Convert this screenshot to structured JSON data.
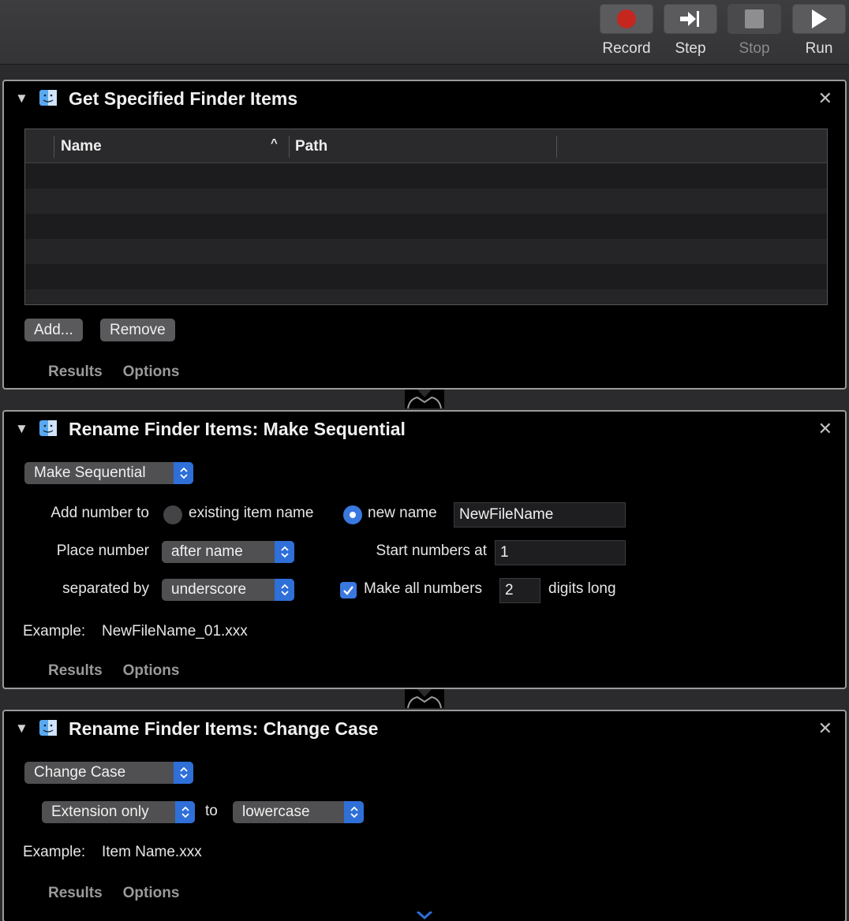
{
  "toolbar": {
    "record": "Record",
    "step": "Step",
    "stop": "Stop",
    "run": "Run"
  },
  "actions": {
    "get_items": {
      "title": "Get Specified Finder Items",
      "columns": [
        "Name",
        "Path"
      ],
      "add_label": "Add...",
      "remove_label": "Remove",
      "results": "Results",
      "options": "Options"
    },
    "sequential": {
      "title": "Rename Finder Items: Make Sequential",
      "mode": "Make Sequential",
      "add_number_to": "Add number to",
      "existing_item_name": "existing item name",
      "new_name": "new name",
      "new_name_value": "NewFileName",
      "place_number": "Place number",
      "place_number_value": "after name",
      "start_numbers_at": "Start numbers at",
      "start_value": "1",
      "separated_by": "separated by",
      "separator_value": "underscore",
      "make_all_numbers": "Make all numbers",
      "digits_value": "2",
      "digits_long": "digits long",
      "example_label": "Example:",
      "example_value": "NewFileName_01.xxx",
      "results": "Results",
      "options": "Options"
    },
    "change_case": {
      "title": "Rename Finder Items: Change Case",
      "mode": "Change Case",
      "scope": "Extension only",
      "to": "to",
      "case_value": "lowercase",
      "example_label": "Example:",
      "example_value": "Item Name.xxx",
      "results": "Results",
      "options": "Options"
    }
  },
  "colors": {
    "accent": "#2f6fd8",
    "record": "#c5271f",
    "panel": "#000000",
    "border": "#9a9a9a"
  }
}
